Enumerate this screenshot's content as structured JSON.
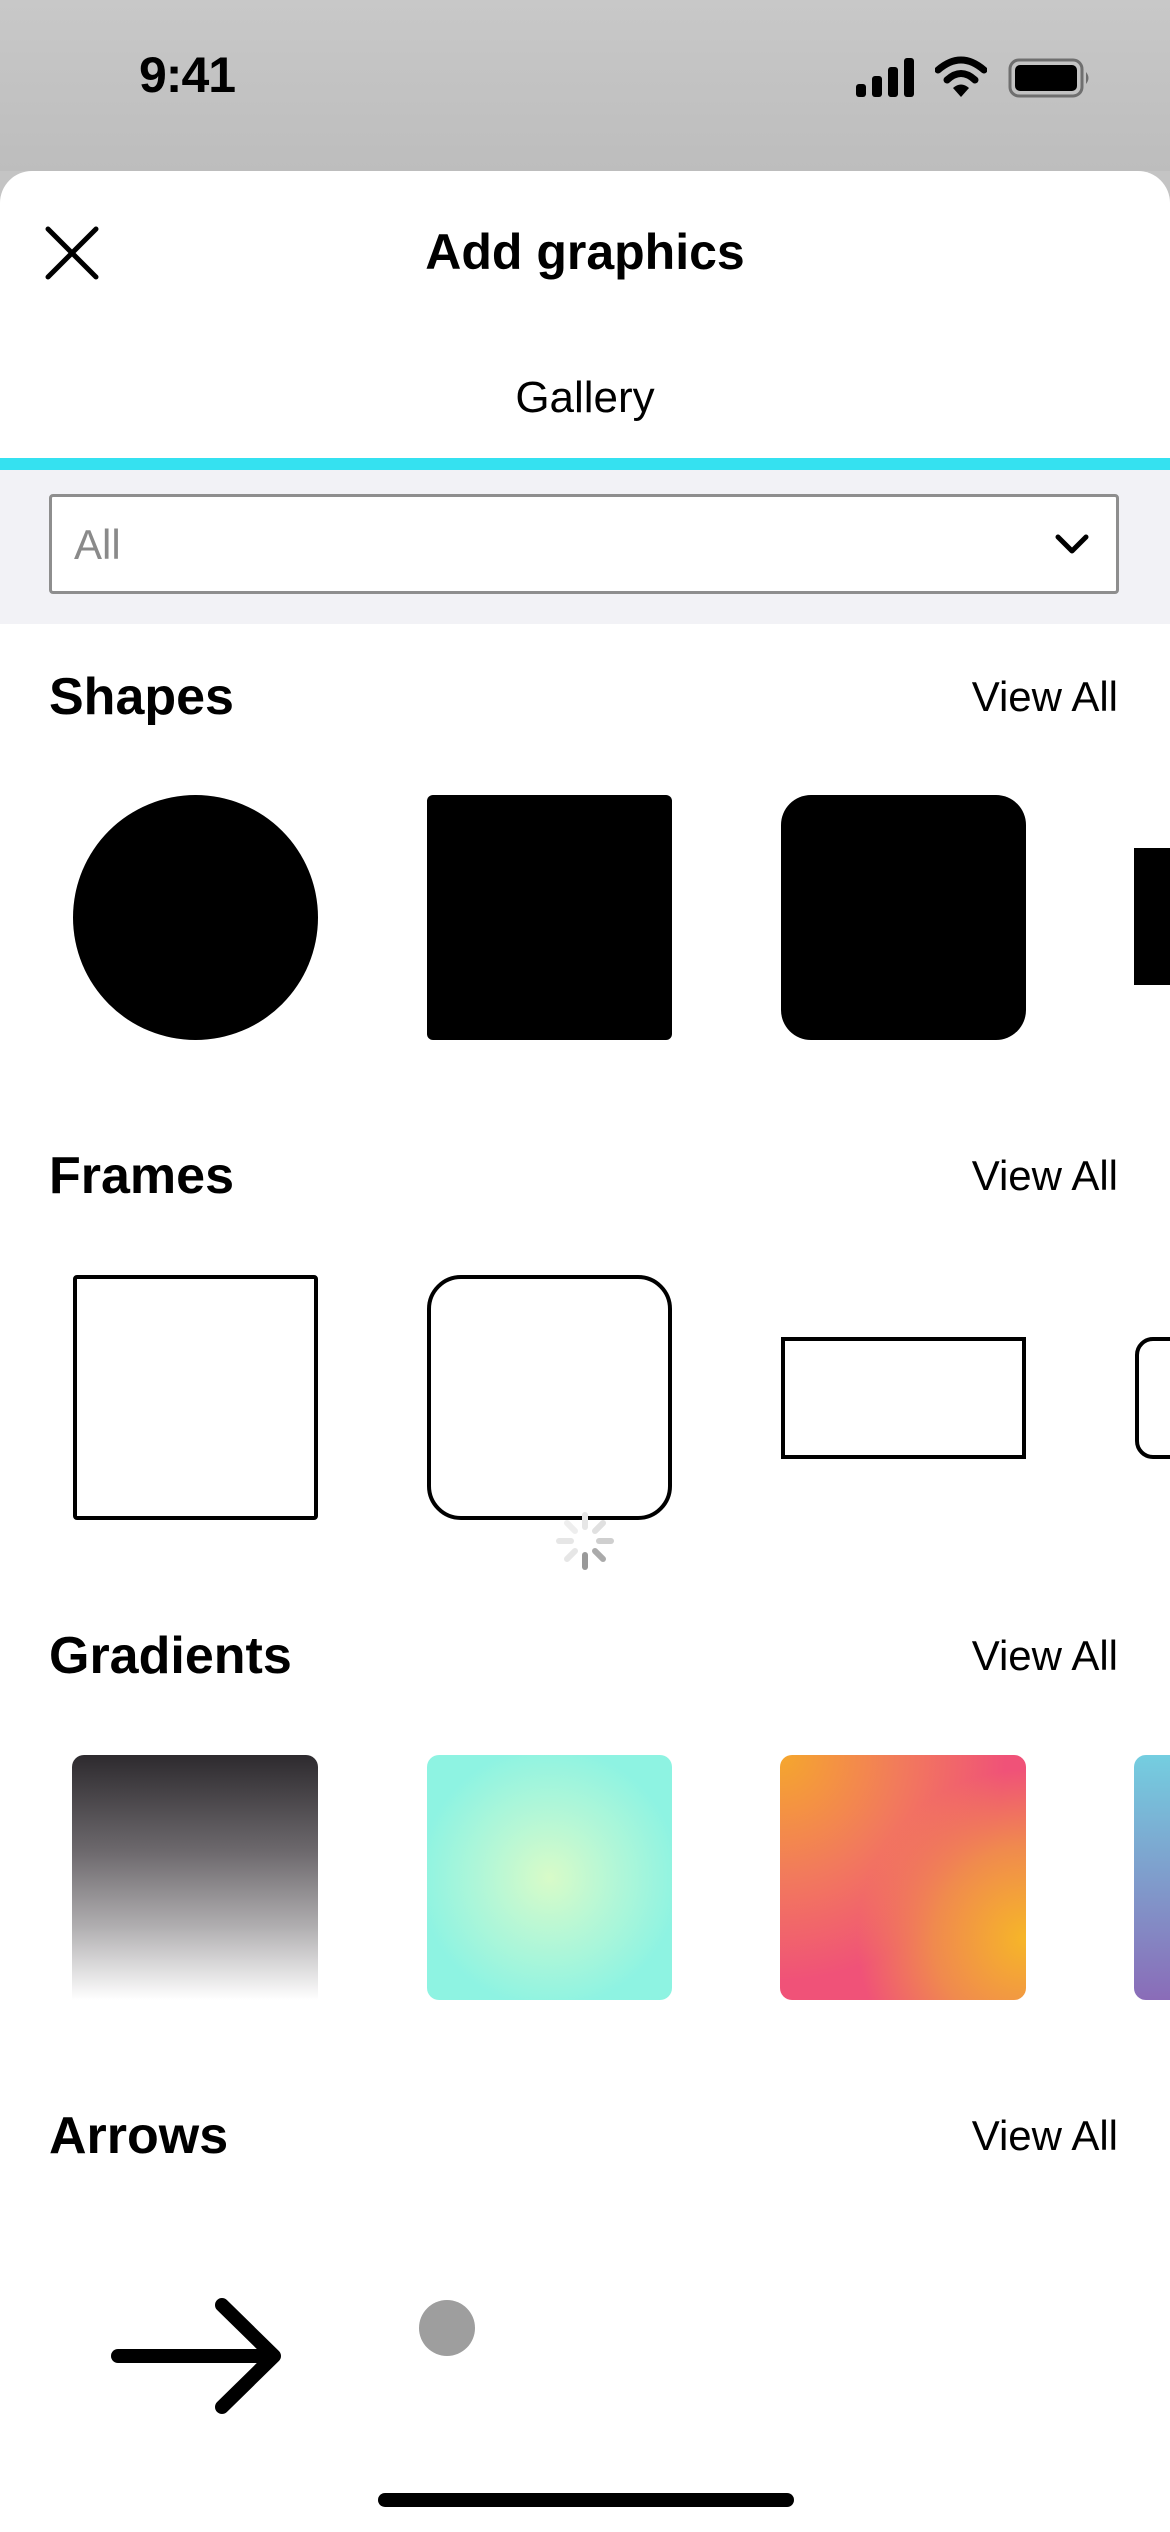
{
  "status": {
    "time": "9:41"
  },
  "header": {
    "title": "Add graphics",
    "close_icon": "close-icon"
  },
  "tabs": [
    {
      "label": "Gallery",
      "active": true,
      "accent": "#35e1f0"
    }
  ],
  "filter": {
    "selected": "All",
    "icon": "chevron-down-icon"
  },
  "sections": [
    {
      "title": "Shapes",
      "action": "View All",
      "items": [
        "circle",
        "square",
        "rounded-square",
        "rectangle"
      ]
    },
    {
      "title": "Frames",
      "action": "View All",
      "items": [
        "square-frame",
        "rounded-square-frame",
        "rectangle-frame",
        "rounded-rectangle-frame"
      ]
    },
    {
      "title": "Gradients",
      "action": "View All",
      "items": [
        "gray-gradient",
        "mint-gradient",
        "sunset-gradient",
        "blue-purple-gradient"
      ]
    },
    {
      "title": "Arrows",
      "action": "View All",
      "items": [
        "right-arrow"
      ]
    }
  ],
  "colors": {
    "accent": "#35e1f0",
    "filter_bg": "#f2f2f6"
  }
}
